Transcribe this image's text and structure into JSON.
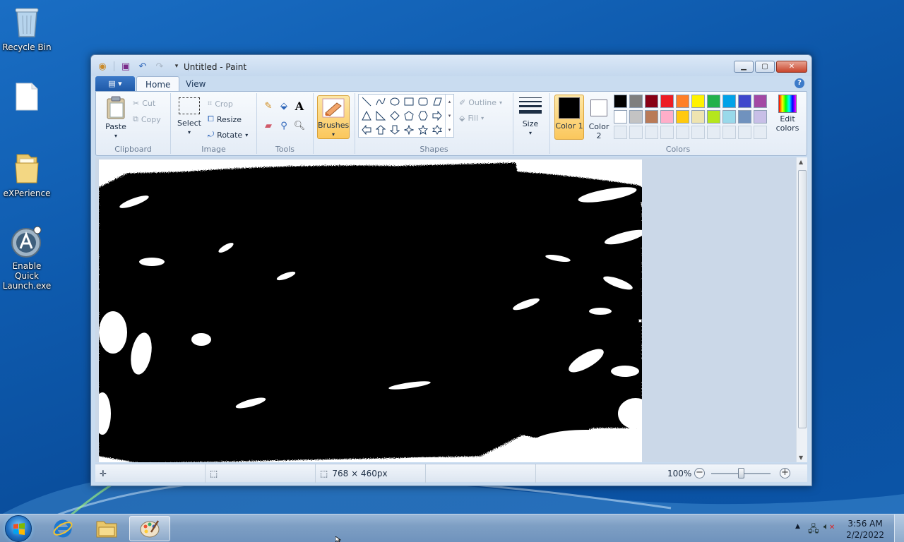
{
  "desktop": {
    "icons": [
      {
        "label": "Recycle Bin"
      },
      {
        "label": ""
      },
      {
        "label": "eXPerience"
      },
      {
        "label": "Enable Quick Launch.exe"
      }
    ]
  },
  "window": {
    "title": "Untitled - Paint",
    "tabs": {
      "file": "",
      "home": "Home",
      "view": "View"
    },
    "help": "?"
  },
  "ribbon": {
    "clipboard": {
      "label": "Clipboard",
      "paste": "Paste",
      "cut": "Cut",
      "copy": "Copy"
    },
    "image": {
      "label": "Image",
      "select": "Select",
      "crop": "Crop",
      "resize": "Resize",
      "rotate": "Rotate"
    },
    "tools": {
      "label": "Tools"
    },
    "brushes": {
      "label": "Brushes"
    },
    "shapes": {
      "label": "Shapes",
      "outline": "Outline",
      "fill": "Fill"
    },
    "size": {
      "label": "Size"
    },
    "colors": {
      "label": "Colors",
      "color1": "Color 1",
      "color1_num": "1",
      "color2": "Color 2",
      "color2_num": "2",
      "edit_colors": "Edit colors",
      "color1_value": "#000000",
      "color2_value": "#ffffff",
      "palette_row1": [
        "#000000",
        "#7f7f7f",
        "#880015",
        "#ed1c24",
        "#ff7f27",
        "#fff200",
        "#22b14c",
        "#00a2e8",
        "#3f48cc",
        "#a349a4"
      ],
      "palette_row2": [
        "#ffffff",
        "#c3c3c3",
        "#b97a57",
        "#ffaec9",
        "#ffc90e",
        "#efe4b0",
        "#b5e61d",
        "#99d9ea",
        "#7092be",
        "#c8bfe7"
      ]
    }
  },
  "statusbar": {
    "dimensions": "768 × 460px",
    "zoom": "100%"
  },
  "taskbar": {
    "time": "3:56 AM",
    "date": "2/2/2022"
  }
}
